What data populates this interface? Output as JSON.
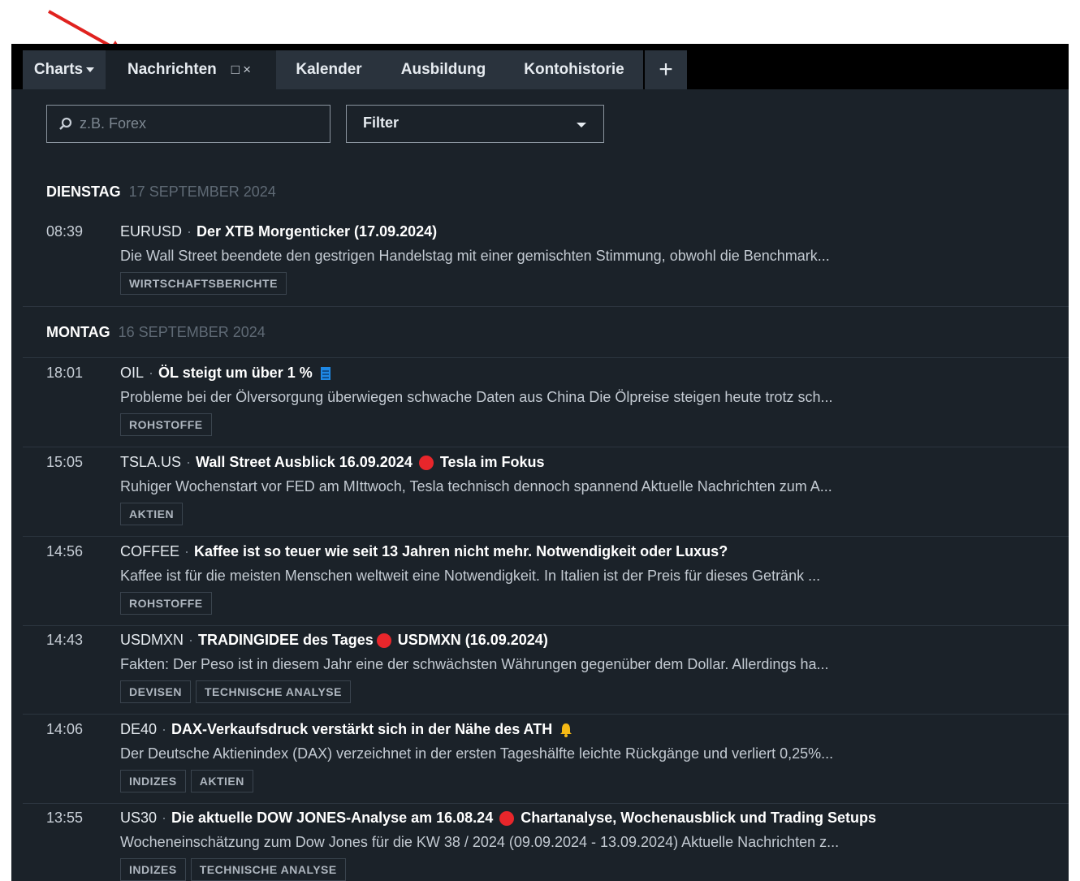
{
  "tabs": [
    {
      "label": "Charts"
    },
    {
      "label": "Nachrichten",
      "controls": "□×"
    },
    {
      "label": "Kalender"
    },
    {
      "label": "Ausbildung"
    },
    {
      "label": "Kontohistorie"
    },
    {
      "label": "+"
    }
  ],
  "search": {
    "placeholder": "z.B. Forex"
  },
  "filter": {
    "label": "Filter"
  },
  "days": [
    {
      "weekday": "DIENSTAG",
      "date": "17 SEPTEMBER 2024"
    },
    {
      "weekday": "MONTAG",
      "date": "16 SEPTEMBER 2024"
    }
  ],
  "news": [
    {
      "time": "08:39",
      "symbol": "EURUSD",
      "title": "Der XTB Morgenticker (17.09.2024)",
      "title2": "",
      "desc": "Die Wall Street beendete den gestrigen Handelstag mit einer gemischten Stimmung, obwohl die Benchmark...",
      "tags": [
        "WIRTSCHAFTSBERICHTE"
      ]
    },
    {
      "time": "18:01",
      "symbol": "OIL",
      "title": "ÖL steigt um über 1 %",
      "title2": "",
      "desc": "Probleme bei der Ölversorgung überwiegen schwache Daten aus China Die Ölpreise steigen heute trotz sch...",
      "tags": [
        "ROHSTOFFE"
      ]
    },
    {
      "time": "15:05",
      "symbol": "TSLA.US",
      "title": "Wall Street Ausblick 16.09.2024",
      "title2": "Tesla im Fokus",
      "desc": "Ruhiger Wochenstart vor FED am MIttwoch, Tesla technisch dennoch spannend Aktuelle Nachrichten zum A...",
      "tags": [
        "AKTIEN"
      ]
    },
    {
      "time": "14:56",
      "symbol": "COFFEE",
      "title": "Kaffee ist so teuer wie seit 13 Jahren nicht mehr. Notwendigkeit oder Luxus?",
      "title2": "",
      "desc": "Kaffee ist für die meisten Menschen weltweit eine Notwendigkeit. In Italien ist der Preis für dieses Getränk ...",
      "tags": [
        "ROHSTOFFE"
      ]
    },
    {
      "time": "14:43",
      "symbol": "USDMXN",
      "title": "TRADINGIDEE des Tages",
      "title2": "USDMXN (16.09.2024)",
      "desc": "Fakten: Der Peso ist in diesem Jahr eine der schwächsten Währungen gegenüber dem Dollar. Allerdings ha...",
      "tags": [
        "DEVISEN",
        "TECHNISCHE ANALYSE"
      ]
    },
    {
      "time": "14:06",
      "symbol": "DE40",
      "title": "DAX-Verkaufsdruck verstärkt sich in der Nähe des ATH",
      "title2": "",
      "desc": "Der Deutsche Aktienindex (DAX) verzeichnet in der ersten Tageshälfte leichte Rückgänge und verliert 0,25%...",
      "tags": [
        "INDIZES",
        "AKTIEN"
      ]
    },
    {
      "time": "13:55",
      "symbol": "US30",
      "title": "Die aktuelle DOW JONES-Analyse am 16.08.24",
      "title2": "Chartanalyse, Wochenausblick und Trading Setups",
      "desc": "Wocheneinschätzung zum Dow Jones für die KW 38 / 2024 (09.09.2024 - 13.09.2024) Aktuelle Nachrichten z...",
      "tags": [
        "INDIZES",
        "TECHNISCHE ANALYSE"
      ]
    }
  ],
  "colors": {
    "panel": "#1b2229",
    "tabbar": "#000000",
    "accent_red": "#e8262b",
    "arrow": "#e0221f"
  }
}
